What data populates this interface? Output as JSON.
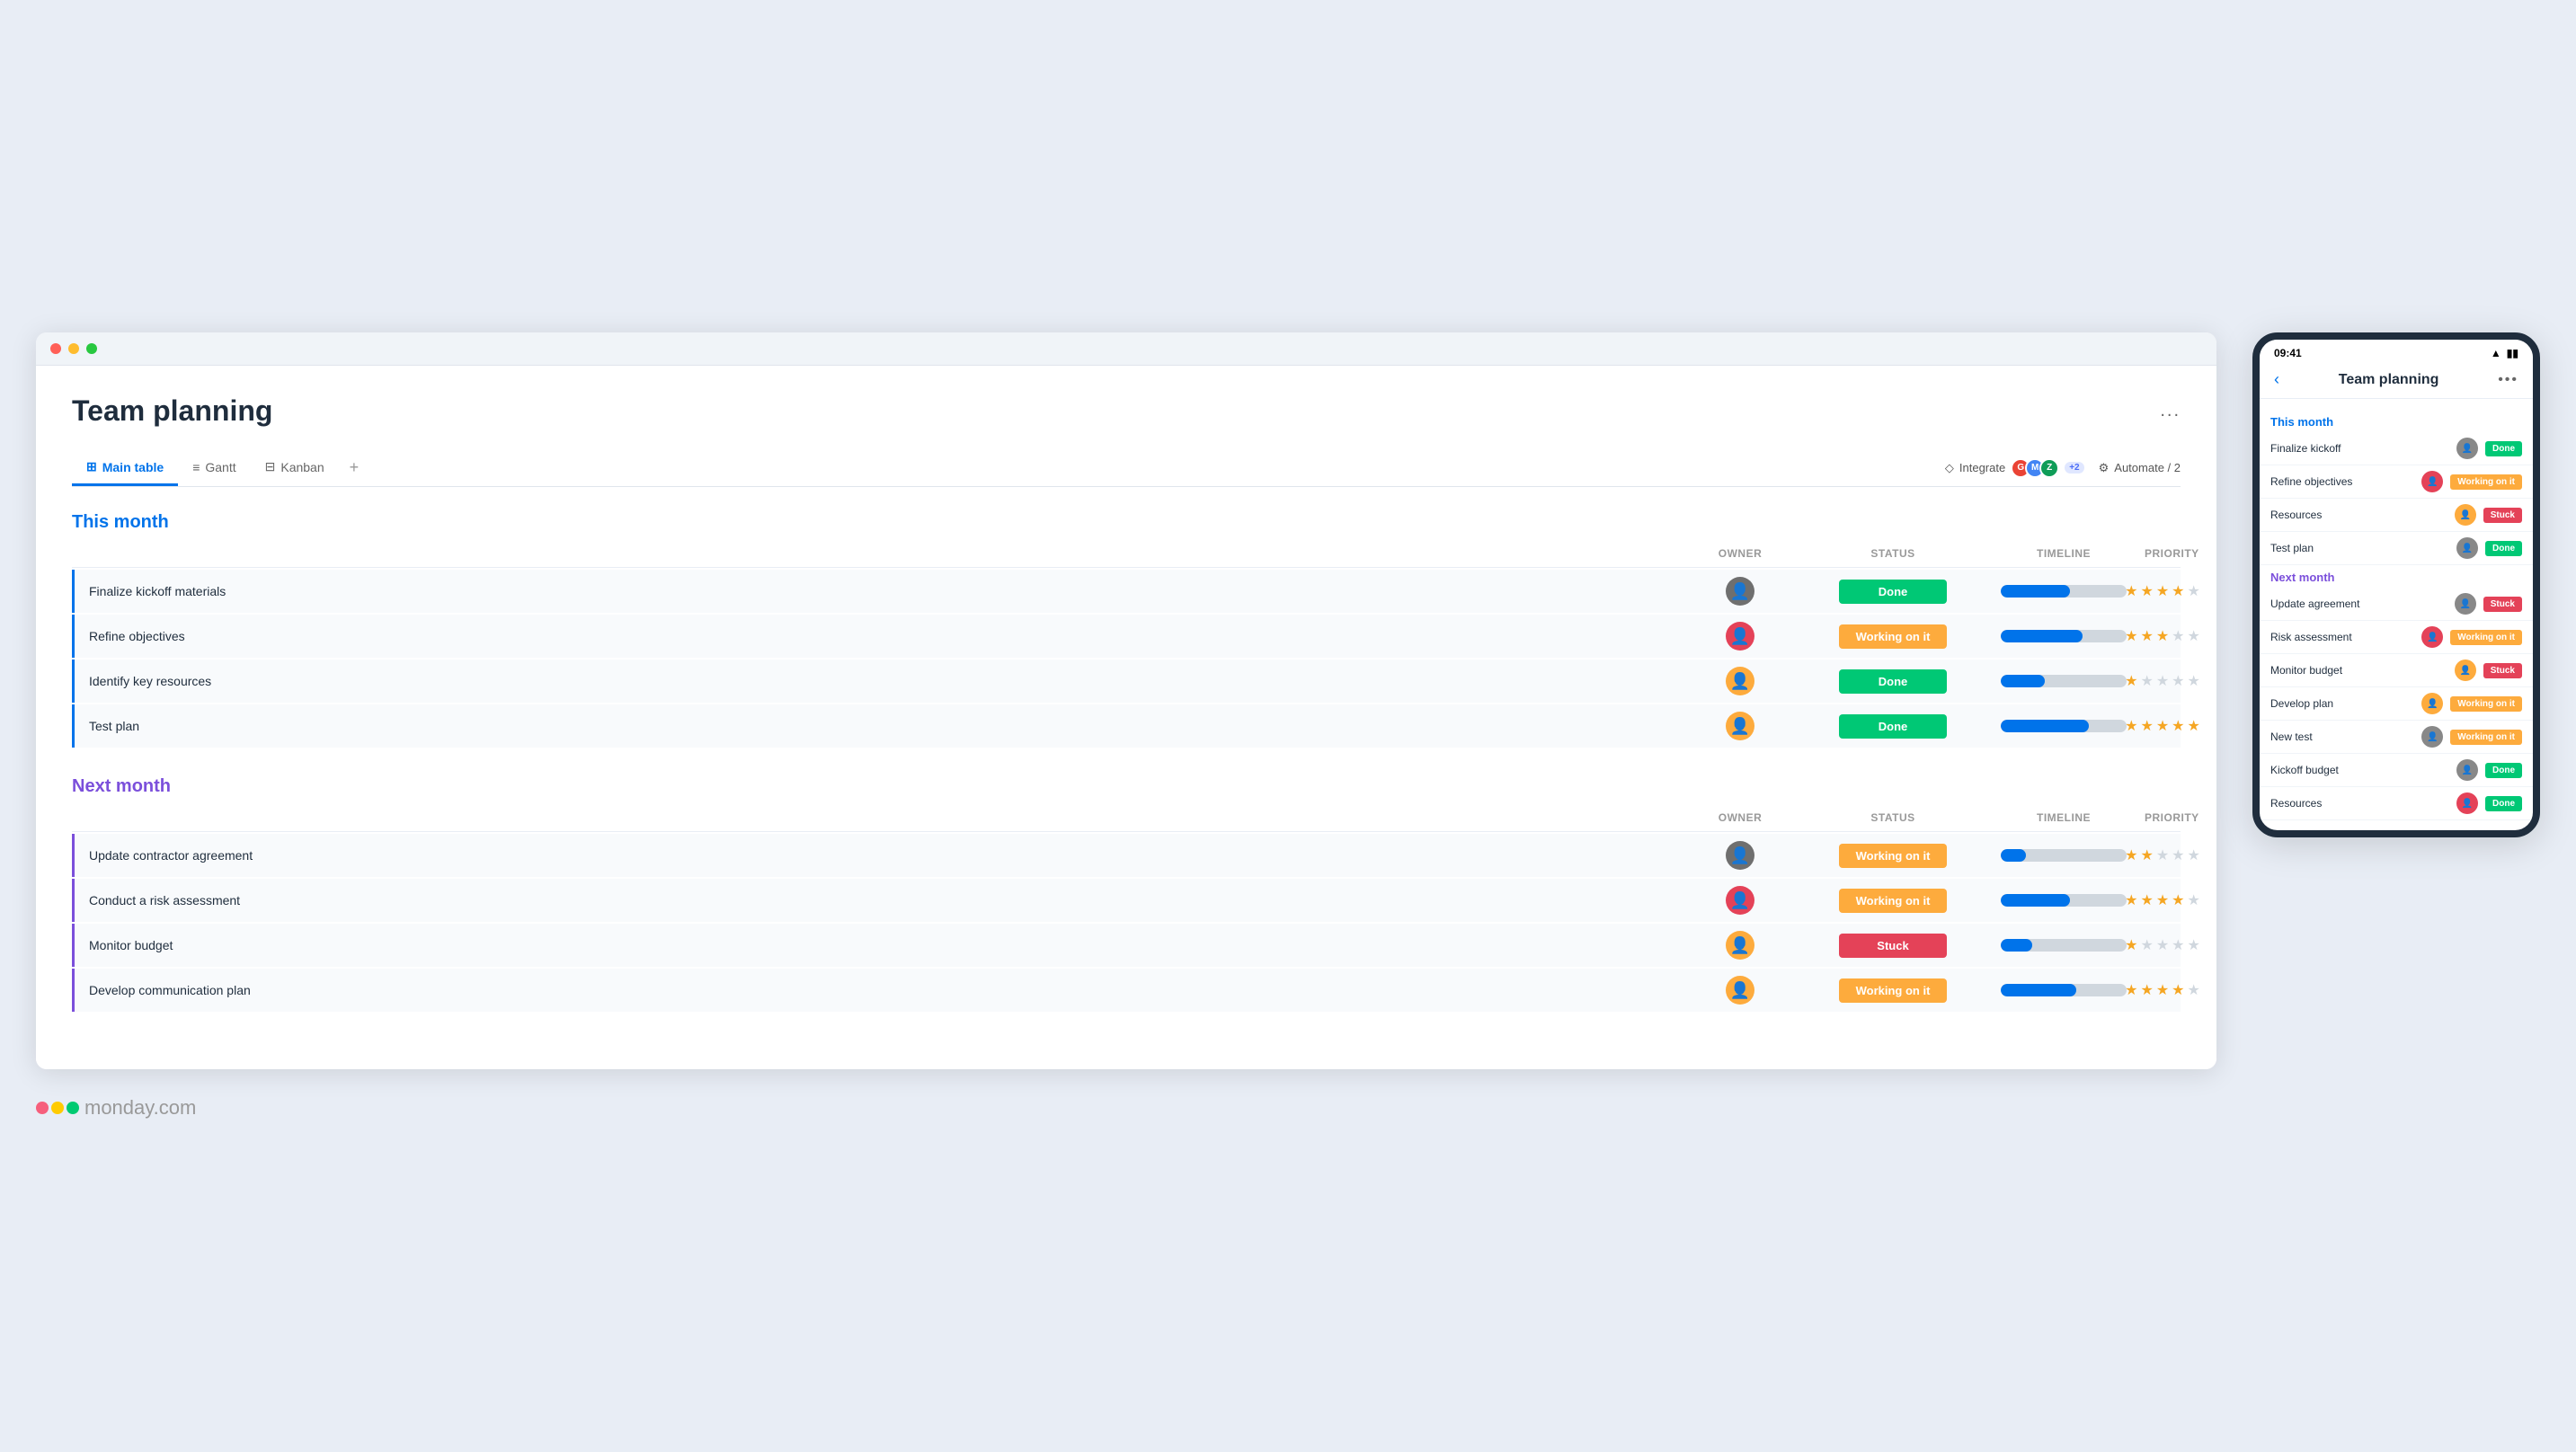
{
  "page": {
    "title": "Team planning",
    "more_button": "...",
    "tabs": [
      {
        "id": "main-table",
        "label": "Main table",
        "active": true,
        "icon": "⊞"
      },
      {
        "id": "gantt",
        "label": "Gantt",
        "active": false,
        "icon": "≡"
      },
      {
        "id": "kanban",
        "label": "Kanban",
        "active": false,
        "icon": "⊟"
      }
    ],
    "tab_add": "+",
    "integrate_label": "Integrate",
    "automate_label": "Automate / 2"
  },
  "this_month": {
    "title": "This month",
    "columns": [
      "",
      "Owner",
      "Status",
      "Timeline",
      "Priority"
    ],
    "rows": [
      {
        "name": "Finalize kickoff materials",
        "owner_color": "#6f6f6f",
        "owner_initials": "👤",
        "status": "Done",
        "status_class": "done",
        "timeline_pct": 55,
        "stars": 4
      },
      {
        "name": "Refine objectives",
        "owner_color": "#e44258",
        "owner_initials": "👤",
        "status": "Working on it",
        "status_class": "working",
        "timeline_pct": 65,
        "stars": 3
      },
      {
        "name": "Identify key resources",
        "owner_color": "#fdab3d",
        "owner_initials": "👤",
        "status": "Done",
        "status_class": "done",
        "timeline_pct": 35,
        "stars": 1
      },
      {
        "name": "Test plan",
        "owner_color": "#fdab3d",
        "owner_initials": "👤",
        "status": "Done",
        "status_class": "done",
        "timeline_pct": 70,
        "stars": 5
      }
    ]
  },
  "next_month": {
    "title": "Next month",
    "columns": [
      "",
      "Owner",
      "Status",
      "Timeline",
      "Priority"
    ],
    "rows": [
      {
        "name": "Update contractor agreement",
        "owner_color": "#6f6f6f",
        "owner_initials": "👤",
        "status": "Working on it",
        "status_class": "working",
        "timeline_pct": 20,
        "stars": 2
      },
      {
        "name": "Conduct a risk assessment",
        "owner_color": "#e44258",
        "owner_initials": "👤",
        "status": "Working on it",
        "status_class": "working",
        "timeline_pct": 55,
        "stars": 4
      },
      {
        "name": "Monitor budget",
        "owner_color": "#fdab3d",
        "owner_initials": "👤",
        "status": "Stuck",
        "status_class": "stuck",
        "timeline_pct": 25,
        "stars": 1
      },
      {
        "name": "Develop communication plan",
        "owner_color": "#fdab3d",
        "owner_initials": "👤",
        "status": "Working on it",
        "status_class": "working",
        "timeline_pct": 60,
        "stars": 4
      }
    ]
  },
  "mobile": {
    "time": "09:41",
    "title": "Team planning",
    "this_month_label": "This month",
    "next_month_label": "Next month",
    "this_month_rows": [
      {
        "name": "Finalize kickoff",
        "status": "Done",
        "status_class": "done",
        "avatar_color": "#888"
      },
      {
        "name": "Refine objectives",
        "status": "Working on it",
        "status_class": "working",
        "avatar_color": "#e44258"
      },
      {
        "name": "Resources",
        "status": "Stuck",
        "status_class": "stuck",
        "avatar_color": "#fdab3d"
      },
      {
        "name": "Test plan",
        "status": "Done",
        "status_class": "done",
        "avatar_color": "#fdab3d"
      }
    ],
    "next_month_rows": [
      {
        "name": "Update agreement",
        "status": "Stuck",
        "status_class": "stuck",
        "avatar_color": "#888"
      },
      {
        "name": "Risk assessment",
        "status": "Working on it",
        "status_class": "working",
        "avatar_color": "#e44258"
      },
      {
        "name": "Monitor budget",
        "status": "Stuck",
        "status_class": "stuck",
        "avatar_color": "#fdab3d"
      },
      {
        "name": "Develop plan",
        "status": "Working on it",
        "status_class": "working",
        "avatar_color": "#fdab3d"
      },
      {
        "name": "New test",
        "status": "Working on it",
        "status_class": "working",
        "avatar_color": "#888"
      },
      {
        "name": "Kickoff budget",
        "status": "Done",
        "status_class": "done",
        "avatar_color": "#888"
      },
      {
        "name": "Resources",
        "status": "Done",
        "status_class": "done",
        "avatar_color": "#e44258"
      }
    ]
  },
  "logo": {
    "text": "monday",
    "suffix": ".com",
    "dot_colors": [
      "#f65f7c",
      "#ffcb00",
      "#00ca72"
    ]
  }
}
